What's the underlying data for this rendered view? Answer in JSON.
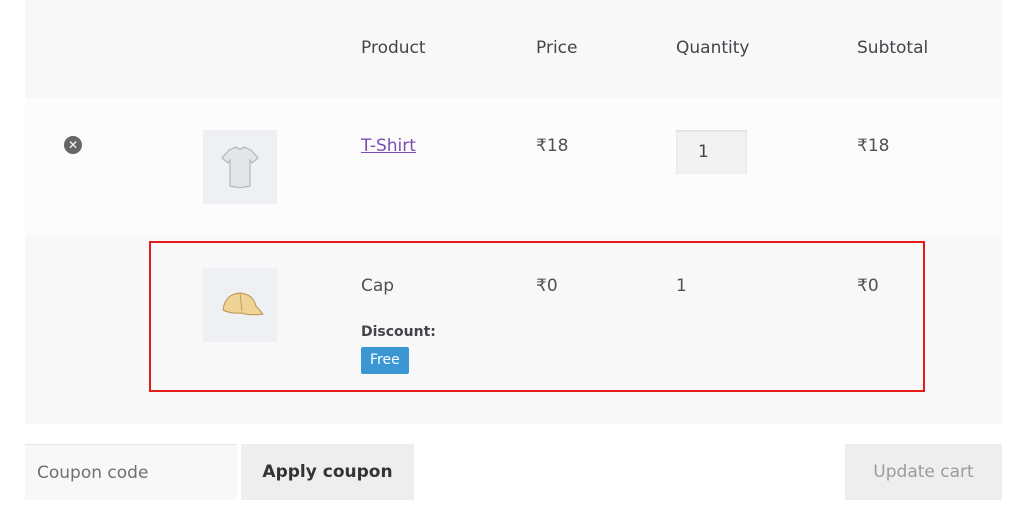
{
  "cart": {
    "headers": {
      "product": "Product",
      "price": "Price",
      "quantity": "Quantity",
      "subtotal": "Subtotal"
    },
    "items": [
      {
        "remove_icon": "remove-circle-icon",
        "name": "T-Shirt",
        "price": "₹18",
        "quantity": "1",
        "subtotal": "₹18"
      },
      {
        "name": "Cap",
        "price": "₹0",
        "quantity": "1",
        "subtotal": "₹0",
        "discount_label": "Discount:",
        "discount_value": "Free"
      }
    ]
  },
  "actions": {
    "coupon_placeholder": "Coupon code",
    "apply_coupon": "Apply coupon",
    "update_cart": "Update cart"
  },
  "colors": {
    "highlight_border": "#e31b1b",
    "badge_bg": "#3b97d3",
    "link": "#7c4bb3"
  }
}
